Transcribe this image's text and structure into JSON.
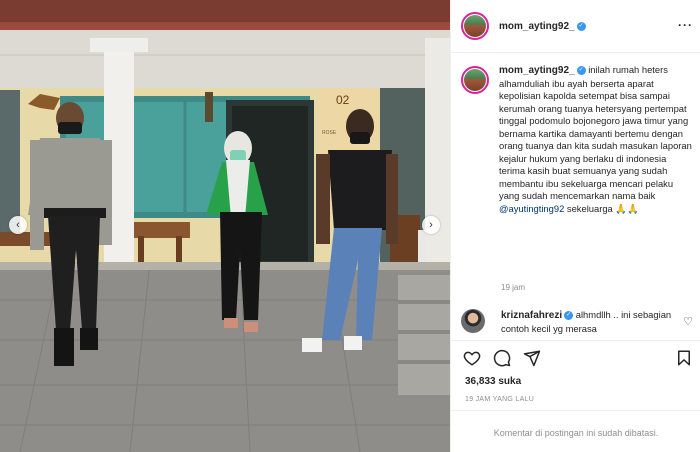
{
  "photo": {
    "alt_left_arrow": "‹",
    "alt_right_arrow": "›",
    "house_number": "02",
    "house_tag": "ROSE"
  },
  "post": {
    "username": "mom_ayting92_",
    "verified_mark": "✓",
    "more_icon": "more-horizontal-icon",
    "caption_text_1": " inilah rumah heters alhamduliah ibu ayah berserta aparat kepolisian kapolda setempat bisa sampai kerumah orang tuanya hetersyang pertempat tinggal podomulo bojonegoro jawa timur yang bernama kartika damayanti bertemu dengan orang tuanya dan kita sudah masukan laporan kejalur hukum yang berlaku di indonesia terima kasih buat semuanya yang sudah membantu ibu sekeluarga mencari pelaku yang sudah mencemarkan nama baik ",
    "caption_mention": "@ayutingting92",
    "caption_text_2": " sekeluarga 🙏🙏",
    "caption_time": "19 jam"
  },
  "comment": {
    "username": "kriznafahrezi",
    "verified_mark": "✓",
    "text": " alhmdllh .. ini sebagian contoh kecil yg merasa",
    "like_icon": "♡"
  },
  "actions": {
    "like_icon": "heart-icon",
    "comment_icon": "comment-icon",
    "share_icon": "share-icon",
    "save_icon": "bookmark-icon"
  },
  "likes": "36,833 suka",
  "post_time": "19 JAM YANG LALU",
  "comments_disabled": "Komentar di postingan ini sudah dibatasi."
}
